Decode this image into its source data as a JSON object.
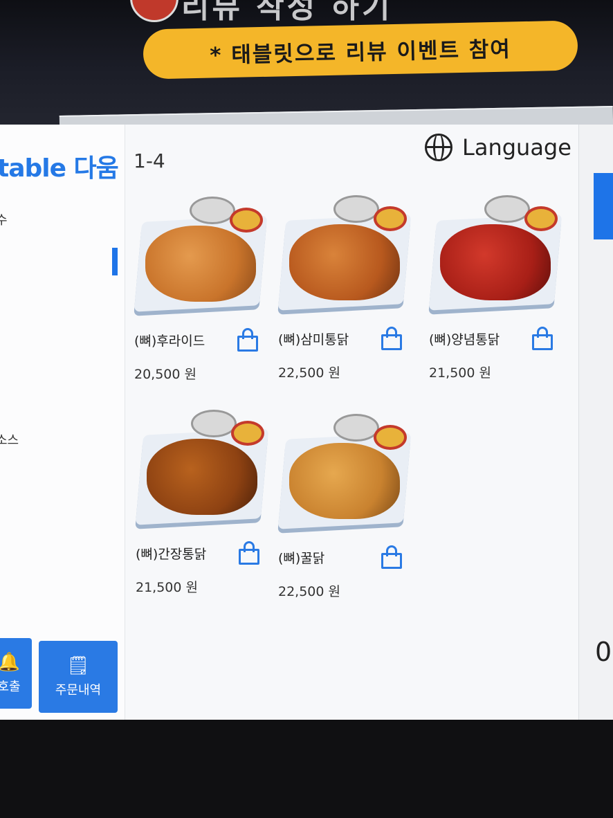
{
  "promo": {
    "headline": "리뷰 작성 하기",
    "subtitle": "* 태블릿으로 리뷰 이벤트 참여"
  },
  "sidebar": {
    "logo": "table 다움",
    "fragment_top": "수",
    "fragment_mid": "소스",
    "buttons": [
      {
        "label": "호출",
        "icon": "bell-icon"
      },
      {
        "label": "주문내역",
        "icon": "receipt-icon"
      }
    ]
  },
  "header": {
    "page": "1-4",
    "language_label": "Language"
  },
  "right_panel": {
    "fragment": "0"
  },
  "menu": [
    {
      "name": "(뼈)후라이드",
      "price": "20,500 원",
      "color": "#c9742b"
    },
    {
      "name": "(뼈)삼미통닭",
      "price": "22,500 원",
      "color": "#b8591e"
    },
    {
      "name": "(뼈)양념통닭",
      "price": "21,500 원",
      "color": "#a81f17"
    },
    {
      "name": "(뼈)간장통닭",
      "price": "21,500 원",
      "color": "#8e4212"
    },
    {
      "name": "(뼈)꿀닭",
      "price": "22,500 원",
      "color": "#c9822f"
    }
  ],
  "colors": {
    "accent": "#2a7ae4"
  }
}
